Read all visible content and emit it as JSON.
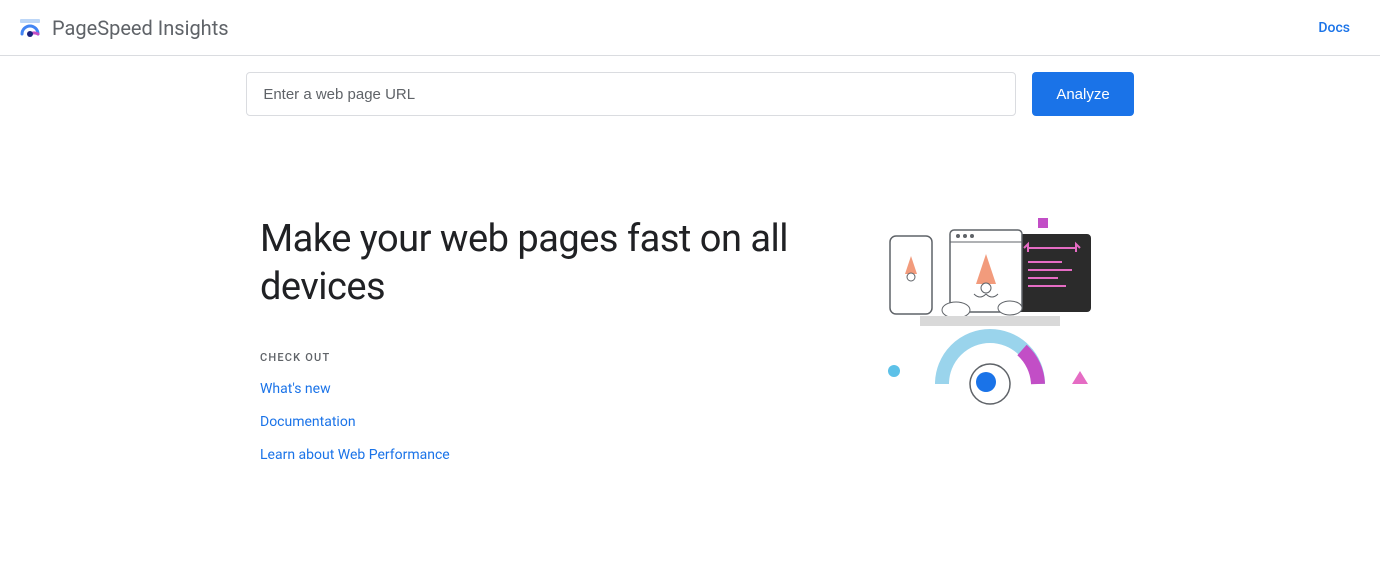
{
  "header": {
    "title": "PageSpeed Insights",
    "docs_label": "Docs"
  },
  "search": {
    "placeholder": "Enter a web page URL",
    "value": "",
    "analyze_label": "Analyze"
  },
  "hero": {
    "heading": "Make your web pages fast on all devices",
    "check_out_label": "CHECK OUT",
    "links": [
      {
        "label": "What's new"
      },
      {
        "label": "Documentation"
      },
      {
        "label": "Learn about Web Performance"
      }
    ]
  }
}
